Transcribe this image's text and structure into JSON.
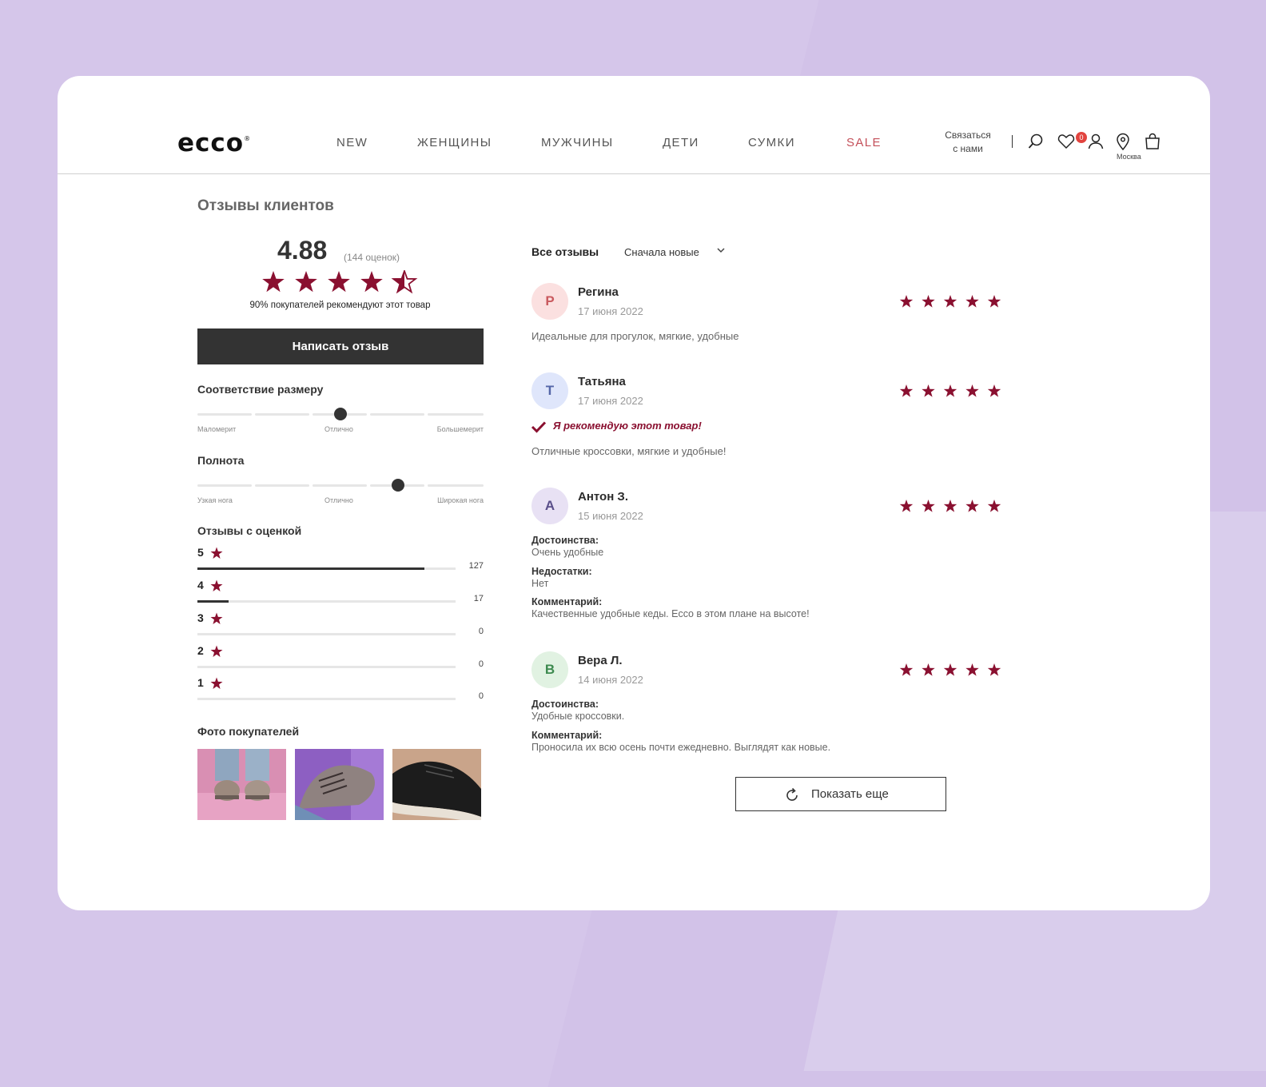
{
  "header": {
    "logo": "ecco",
    "nav": [
      "NEW",
      "ЖЕНЩИНЫ",
      "МУЖЧИНЫ",
      "ДЕТИ",
      "СУМКИ",
      "SALE"
    ],
    "contact": [
      "Связаться",
      "с нами"
    ],
    "wishlist_count": "0",
    "city": "Москва",
    "icons": [
      "search-icon",
      "heart-icon",
      "user-icon",
      "location-pin-icon",
      "shopping-bag-icon"
    ]
  },
  "summary": {
    "title": "Отзывы клиентов",
    "rating": "4.88",
    "rating_value": 4.88,
    "count": "(144 оценок)",
    "recommend": "90% покупателей рекомендуют этот товар",
    "write_button": "Написать отзыв"
  },
  "fit": {
    "title": "Соответствие размеру",
    "labels": [
      "Маломерит",
      "Отлично",
      "Большемерит"
    ],
    "level": 0.5
  },
  "width": {
    "title": "Полнота",
    "labels": [
      "Узкая нога",
      "Отлично",
      "Широкая нога"
    ],
    "level": 0.7
  },
  "distribution": {
    "title": "Отзывы с оценкой",
    "rows": [
      {
        "stars": "5",
        "count": "127",
        "fraction": 0.88
      },
      {
        "stars": "4",
        "count": "17",
        "fraction": 0.12
      },
      {
        "stars": "3",
        "count": "0",
        "fraction": 0
      },
      {
        "stars": "2",
        "count": "0",
        "fraction": 0
      },
      {
        "stars": "1",
        "count": "0",
        "fraction": 0
      }
    ]
  },
  "photos": {
    "title": "Фото покупателей"
  },
  "reviews_header": {
    "filter": "Все отзывы",
    "sort": "Сначала новые"
  },
  "reviews": [
    {
      "initial": "Р",
      "name": "Регина",
      "date": "17 июня 2022",
      "stars": 5,
      "text": "Идеальные для прогулок, мягкие, удобные"
    },
    {
      "initial": "Т",
      "name": "Татьяна",
      "date": "17 июня 2022",
      "stars": 5,
      "recommend": "Я рекомендую этот товар!",
      "text": "Отличные кроссовки, мягкие и удобные!"
    },
    {
      "initial": "А",
      "name": "Антон З.",
      "date": "15 июня 2022",
      "stars": 5,
      "pros_label": "Достоинства:",
      "pros": "Очень удобные",
      "cons_label": "Недостатки:",
      "cons": "Нет",
      "comment_label": "Комментарий:",
      "comment": "Качественные удобные кеды. Ecco в этом плане на высоте!"
    },
    {
      "initial": "В",
      "name": "Вера Л.",
      "date": "14 июня 2022",
      "stars": 5,
      "pros_label": "Достоинства:",
      "pros": "Удобные кроссовки.",
      "comment_label": "Комментарий:",
      "comment": "Проносила их всю осень почти ежедневно. Выглядят как новые."
    }
  ],
  "more_button": "Показать еще",
  "colors": {
    "accent": "#8a1030",
    "dark": "#333333",
    "sale": "#c4505a",
    "badge": "#e2443f"
  }
}
